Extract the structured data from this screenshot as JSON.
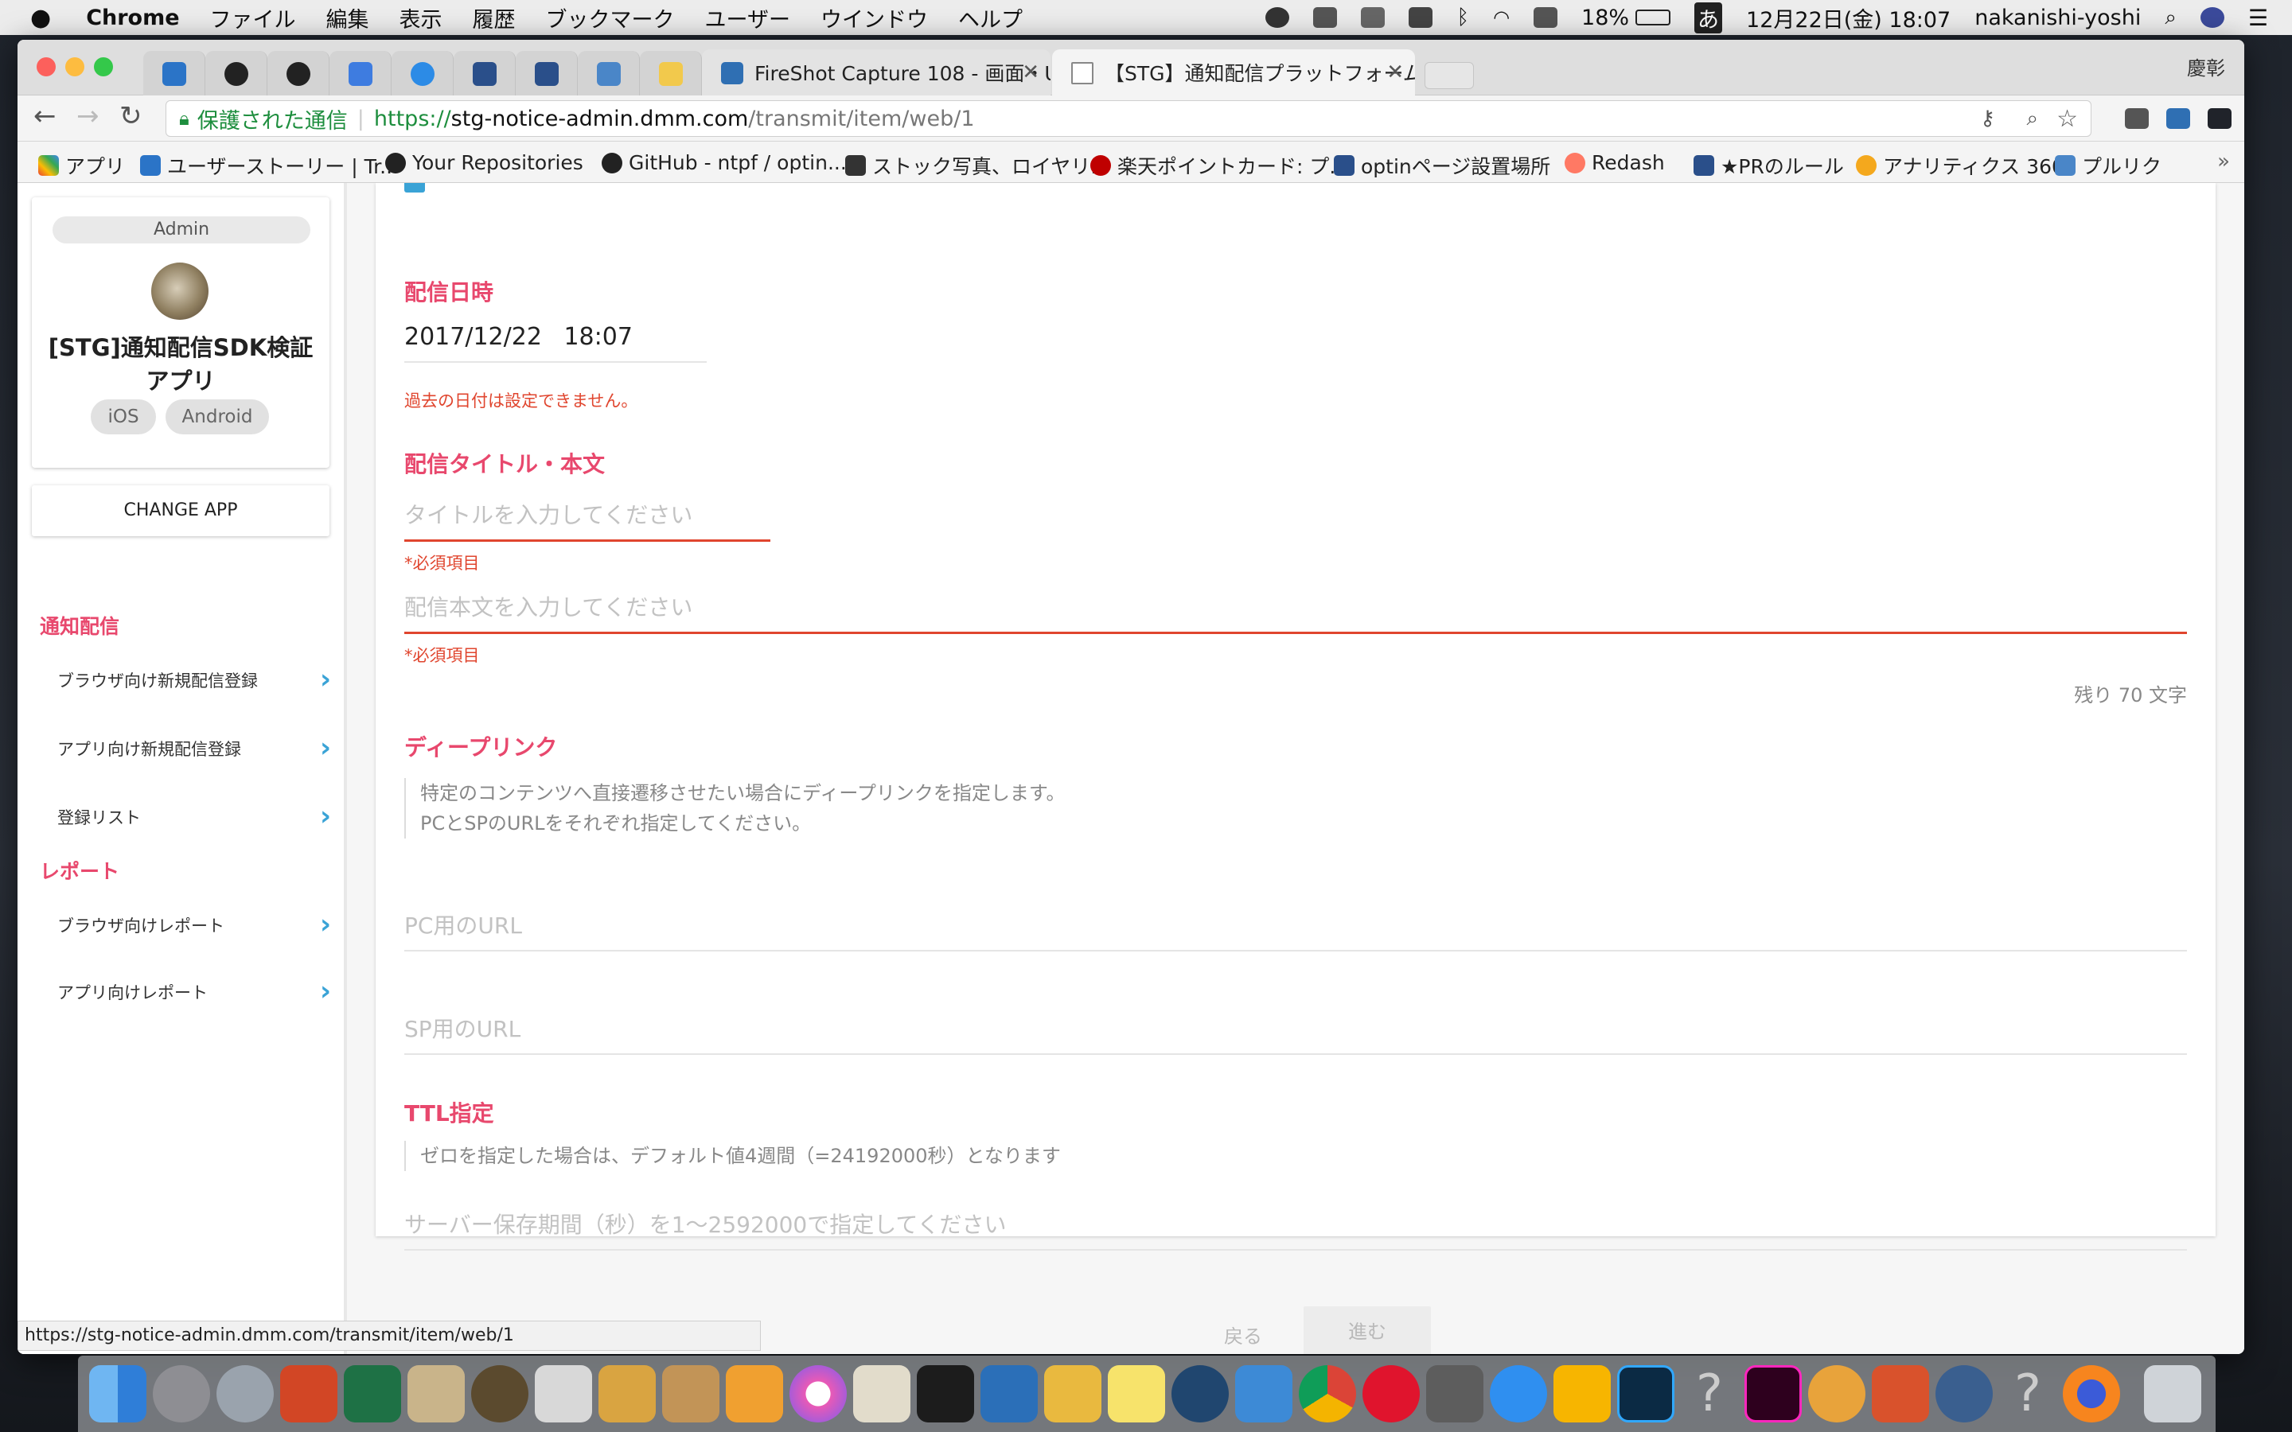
{
  "menubar": {
    "app": "Chrome",
    "menus": [
      "ファイル",
      "編集",
      "表示",
      "履歴",
      "ブックマーク",
      "ユーザー",
      "ウインドウ",
      "ヘルプ"
    ],
    "battery": "18%",
    "input_method": "あ",
    "clock": "12月22日(金)  18:07",
    "user": "nakanishi-yoshi"
  },
  "browser": {
    "profile": "慶彰",
    "tabs": [
      {
        "title": "FireShot Capture 108 - 画面・U",
        "active": false
      },
      {
        "title": "【STG】通知配信プラットフォーム",
        "active": true
      }
    ],
    "secure_label": "保護された通信",
    "url_scheme": "https://",
    "url_host": "stg-notice-admin.dmm.com",
    "url_path": "/transmit/item/web/1",
    "bookmarks": [
      "アプリ",
      "ユーザーストーリー | Tr...",
      "Your Repositories",
      "GitHub - ntpf / optin...",
      "ストック写真、ロイヤリ...",
      "楽天ポイントカード: プ...",
      "optinページ設置場所",
      "Redash",
      "★PRのルール",
      "アナリティクス 360",
      "プルリク"
    ],
    "status_url": "https://stg-notice-admin.dmm.com/transmit/item/web/1"
  },
  "sidebar": {
    "role": "Admin",
    "app_name": "[STG]通知配信SDK検証アプリ",
    "platforms": [
      "iOS",
      "Android"
    ],
    "change_app": "CHANGE APP",
    "sections": [
      {
        "title": "通知配信",
        "items": [
          "ブラウザ向け新規配信登録",
          "アプリ向け新規配信登録",
          "登録リスト"
        ]
      },
      {
        "title": "レポート",
        "items": [
          "ブラウザ向けレポート",
          "アプリ向けレポート"
        ]
      }
    ]
  },
  "form": {
    "schedule": {
      "heading": "配信日時",
      "date": "2017/12/22",
      "time": "18:07",
      "error": "過去の日付は設定できません。"
    },
    "content": {
      "heading": "配信タイトル・本文",
      "title_placeholder": "タイトルを入力してください",
      "body_placeholder": "配信本文を入力してください",
      "required": "*必須項目",
      "remaining": "残り 70 文字"
    },
    "deeplink": {
      "heading": "ディープリンク",
      "help_line1": "特定のコンテンツへ直接遷移させたい場合にディープリンクを指定します。",
      "help_line2": "PCとSPのURLをそれぞれ指定してください。",
      "pc_placeholder": "PC用のURL",
      "sp_placeholder": "SP用のURL"
    },
    "ttl": {
      "heading": "TTL指定",
      "help": "ゼロを指定した場合は、デフォルト値4週間（=24192000秒）となります",
      "placeholder": "サーバー保存期間（秒）を1〜2592000で指定してください"
    },
    "back_label": "戻る",
    "next_label": "進む"
  },
  "colors": {
    "accent_pink": "#e8486d",
    "error_red": "#e0452e",
    "chevron_blue": "#3aa3d6"
  }
}
